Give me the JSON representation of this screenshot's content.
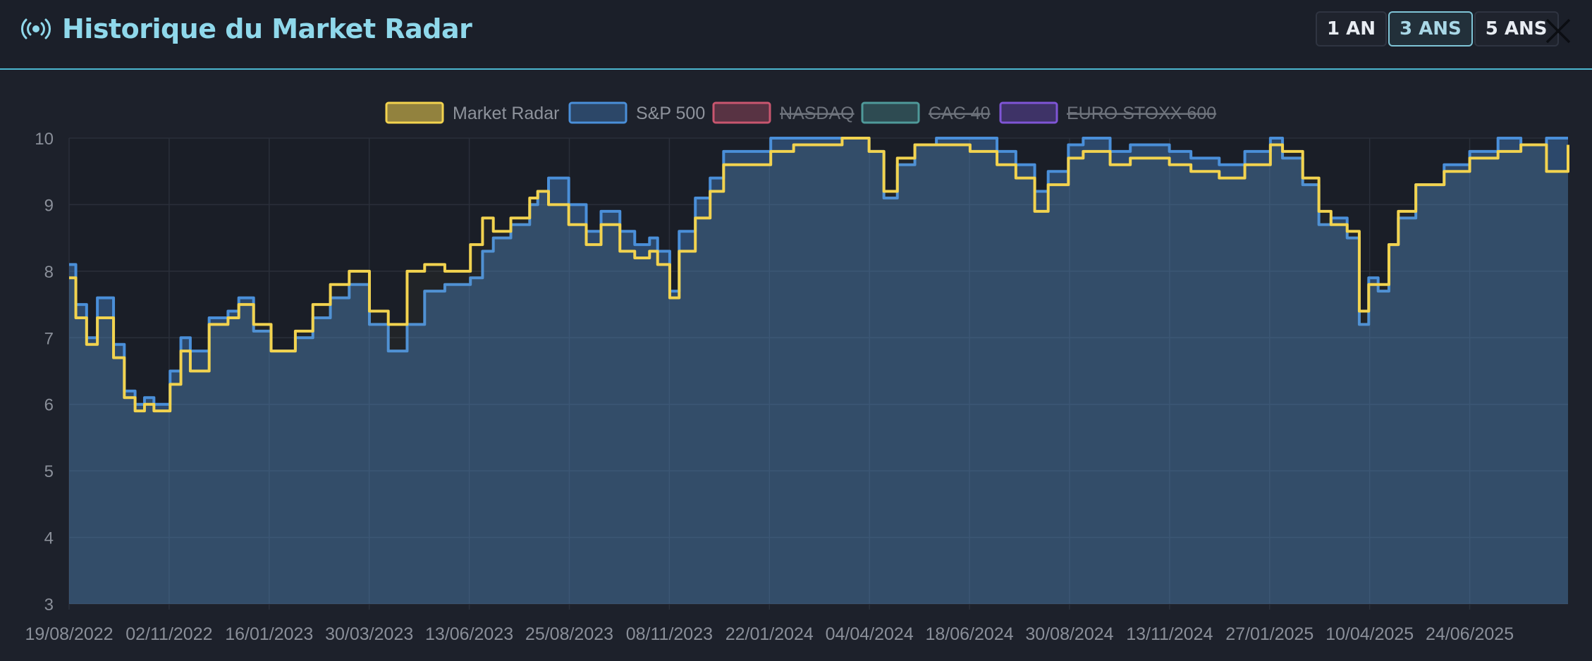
{
  "header": {
    "title": "Historique du Market Radar",
    "icon": "radio-signal-icon",
    "periods": [
      "1 AN",
      "3 ANS",
      "5 ANS"
    ],
    "active_period": "3 ANS",
    "close_icon": "close-icon"
  },
  "colors": {
    "background": "#1d212b",
    "accent": "#4cb7cf",
    "market_radar": "#f2d34f",
    "sp500": "#4a8fd9",
    "nasdaq": "#c9566f",
    "cac40": "#4f9a9a",
    "eurostoxx": "#7f55d6"
  },
  "chart_data": {
    "type": "line",
    "title": "",
    "xlabel": "",
    "ylabel": "",
    "ylim": [
      3,
      10
    ],
    "yticks": [
      3,
      4,
      5,
      6,
      7,
      8,
      9,
      10
    ],
    "x_tick_labels": [
      "19/08/2022",
      "02/11/2022",
      "16/01/2023",
      "30/03/2023",
      "13/06/2023",
      "25/08/2023",
      "08/11/2023",
      "22/01/2024",
      "04/04/2024",
      "18/06/2024",
      "30/08/2024",
      "13/11/2024",
      "27/01/2025",
      "10/04/2025",
      "24/06/2025"
    ],
    "grid": true,
    "legend_position": "top-center",
    "legend": [
      {
        "name": "Market Radar",
        "hidden": false
      },
      {
        "name": "S&P 500",
        "hidden": false
      },
      {
        "name": "NASDAQ",
        "hidden": true
      },
      {
        "name": "CAC 40",
        "hidden": true
      },
      {
        "name": "EURO STOXX 600",
        "hidden": true
      }
    ],
    "series": [
      {
        "name": "S&P 500",
        "x": [
          "19/08/2022",
          "24/08/2022",
          "01/09/2022",
          "09/09/2022",
          "21/09/2022",
          "29/09/2022",
          "07/10/2022",
          "14/10/2022",
          "21/10/2022",
          "02/11/2022",
          "10/11/2022",
          "17/11/2022",
          "01/12/2022",
          "15/12/2022",
          "23/12/2022",
          "03/01/2023",
          "16/01/2023",
          "25/01/2023",
          "03/02/2023",
          "16/02/2023",
          "01/03/2023",
          "15/03/2023",
          "30/03/2023",
          "13/04/2023",
          "27/04/2023",
          "10/05/2023",
          "25/05/2023",
          "13/06/2023",
          "22/06/2023",
          "30/06/2023",
          "13/07/2023",
          "27/07/2023",
          "02/08/2023",
          "10/08/2023",
          "25/08/2023",
          "07/09/2023",
          "18/09/2023",
          "02/10/2023",
          "13/10/2023",
          "24/10/2023",
          "30/10/2023",
          "08/11/2023",
          "15/11/2023",
          "27/11/2023",
          "08/12/2023",
          "18/12/2023",
          "22/01/2024",
          "08/02/2024",
          "15/03/2024",
          "04/04/2024",
          "15/04/2024",
          "25/04/2024",
          "08/05/2024",
          "24/05/2024",
          "18/06/2024",
          "08/07/2024",
          "22/07/2024",
          "05/08/2024",
          "15/08/2024",
          "30/08/2024",
          "10/09/2024",
          "30/09/2024",
          "15/10/2024",
          "13/11/2024",
          "29/11/2024",
          "20/12/2024",
          "08/01/2025",
          "27/01/2025",
          "05/02/2025",
          "20/02/2025",
          "04/03/2025",
          "13/03/2025",
          "25/03/2025",
          "03/04/2025",
          "10/04/2025",
          "17/04/2025",
          "25/04/2025",
          "02/05/2025",
          "15/05/2025",
          "05/06/2025",
          "24/06/2025",
          "15/07/2025",
          "01/08/2025",
          "20/08/2025",
          "05/09/2025"
        ],
        "values": [
          8.1,
          7.5,
          7.0,
          7.6,
          6.9,
          6.2,
          6.0,
          6.1,
          6.0,
          6.5,
          7.0,
          6.8,
          7.3,
          7.4,
          7.6,
          7.1,
          6.8,
          6.8,
          7.0,
          7.3,
          7.6,
          7.8,
          7.2,
          6.8,
          7.2,
          7.7,
          7.8,
          7.9,
          8.3,
          8.5,
          8.7,
          9.0,
          9.2,
          9.4,
          9.0,
          8.6,
          8.9,
          8.6,
          8.4,
          8.5,
          8.3,
          7.7,
          8.6,
          9.1,
          9.4,
          9.8,
          10.0,
          10.0,
          10.0,
          9.8,
          9.1,
          9.6,
          9.9,
          10.0,
          10.0,
          9.8,
          9.6,
          9.2,
          9.5,
          9.9,
          10.0,
          9.8,
          9.9,
          9.8,
          9.7,
          9.6,
          9.8,
          10.0,
          9.7,
          9.3,
          8.7,
          8.8,
          8.5,
          7.2,
          7.9,
          7.7,
          8.4,
          8.8,
          9.3,
          9.6,
          9.8,
          10.0,
          9.9,
          10.0,
          10.0
        ]
      },
      {
        "name": "Market Radar",
        "x": [
          "19/08/2022",
          "24/08/2022",
          "01/09/2022",
          "09/09/2022",
          "21/09/2022",
          "29/09/2022",
          "07/10/2022",
          "14/10/2022",
          "21/10/2022",
          "02/11/2022",
          "10/11/2022",
          "17/11/2022",
          "01/12/2022",
          "15/12/2022",
          "23/12/2022",
          "03/01/2023",
          "16/01/2023",
          "25/01/2023",
          "03/02/2023",
          "16/02/2023",
          "01/03/2023",
          "15/03/2023",
          "30/03/2023",
          "13/04/2023",
          "27/04/2023",
          "10/05/2023",
          "25/05/2023",
          "13/06/2023",
          "22/06/2023",
          "30/06/2023",
          "13/07/2023",
          "27/07/2023",
          "02/08/2023",
          "10/08/2023",
          "25/08/2023",
          "07/09/2023",
          "18/09/2023",
          "02/10/2023",
          "13/10/2023",
          "24/10/2023",
          "30/10/2023",
          "08/11/2023",
          "15/11/2023",
          "27/11/2023",
          "08/12/2023",
          "18/12/2023",
          "22/01/2024",
          "08/02/2024",
          "15/03/2024",
          "04/04/2024",
          "15/04/2024",
          "25/04/2024",
          "08/05/2024",
          "24/05/2024",
          "18/06/2024",
          "08/07/2024",
          "22/07/2024",
          "05/08/2024",
          "15/08/2024",
          "30/08/2024",
          "10/09/2024",
          "30/09/2024",
          "15/10/2024",
          "13/11/2024",
          "29/11/2024",
          "20/12/2024",
          "08/01/2025",
          "27/01/2025",
          "05/02/2025",
          "20/02/2025",
          "04/03/2025",
          "13/03/2025",
          "25/03/2025",
          "03/04/2025",
          "10/04/2025",
          "17/04/2025",
          "25/04/2025",
          "02/05/2025",
          "15/05/2025",
          "05/06/2025",
          "24/06/2025",
          "15/07/2025",
          "01/08/2025",
          "20/08/2025",
          "05/09/2025"
        ],
        "values": [
          7.9,
          7.3,
          6.9,
          7.3,
          6.7,
          6.1,
          5.9,
          6.0,
          5.9,
          6.3,
          6.8,
          6.5,
          7.2,
          7.3,
          7.5,
          7.2,
          6.8,
          6.8,
          7.1,
          7.5,
          7.8,
          8.0,
          7.4,
          7.2,
          8.0,
          8.1,
          8.0,
          8.4,
          8.8,
          8.6,
          8.8,
          9.1,
          9.2,
          9.0,
          8.7,
          8.4,
          8.7,
          8.3,
          8.2,
          8.3,
          8.1,
          7.6,
          8.3,
          8.8,
          9.2,
          9.6,
          9.8,
          9.9,
          10.0,
          9.8,
          9.2,
          9.7,
          9.9,
          9.9,
          9.8,
          9.6,
          9.4,
          8.9,
          9.3,
          9.7,
          9.8,
          9.6,
          9.7,
          9.6,
          9.5,
          9.4,
          9.6,
          9.9,
          9.8,
          9.4,
          8.9,
          8.7,
          8.6,
          7.4,
          7.8,
          7.8,
          8.4,
          8.9,
          9.3,
          9.5,
          9.7,
          9.8,
          9.9,
          9.5,
          9.9
        ]
      }
    ]
  }
}
